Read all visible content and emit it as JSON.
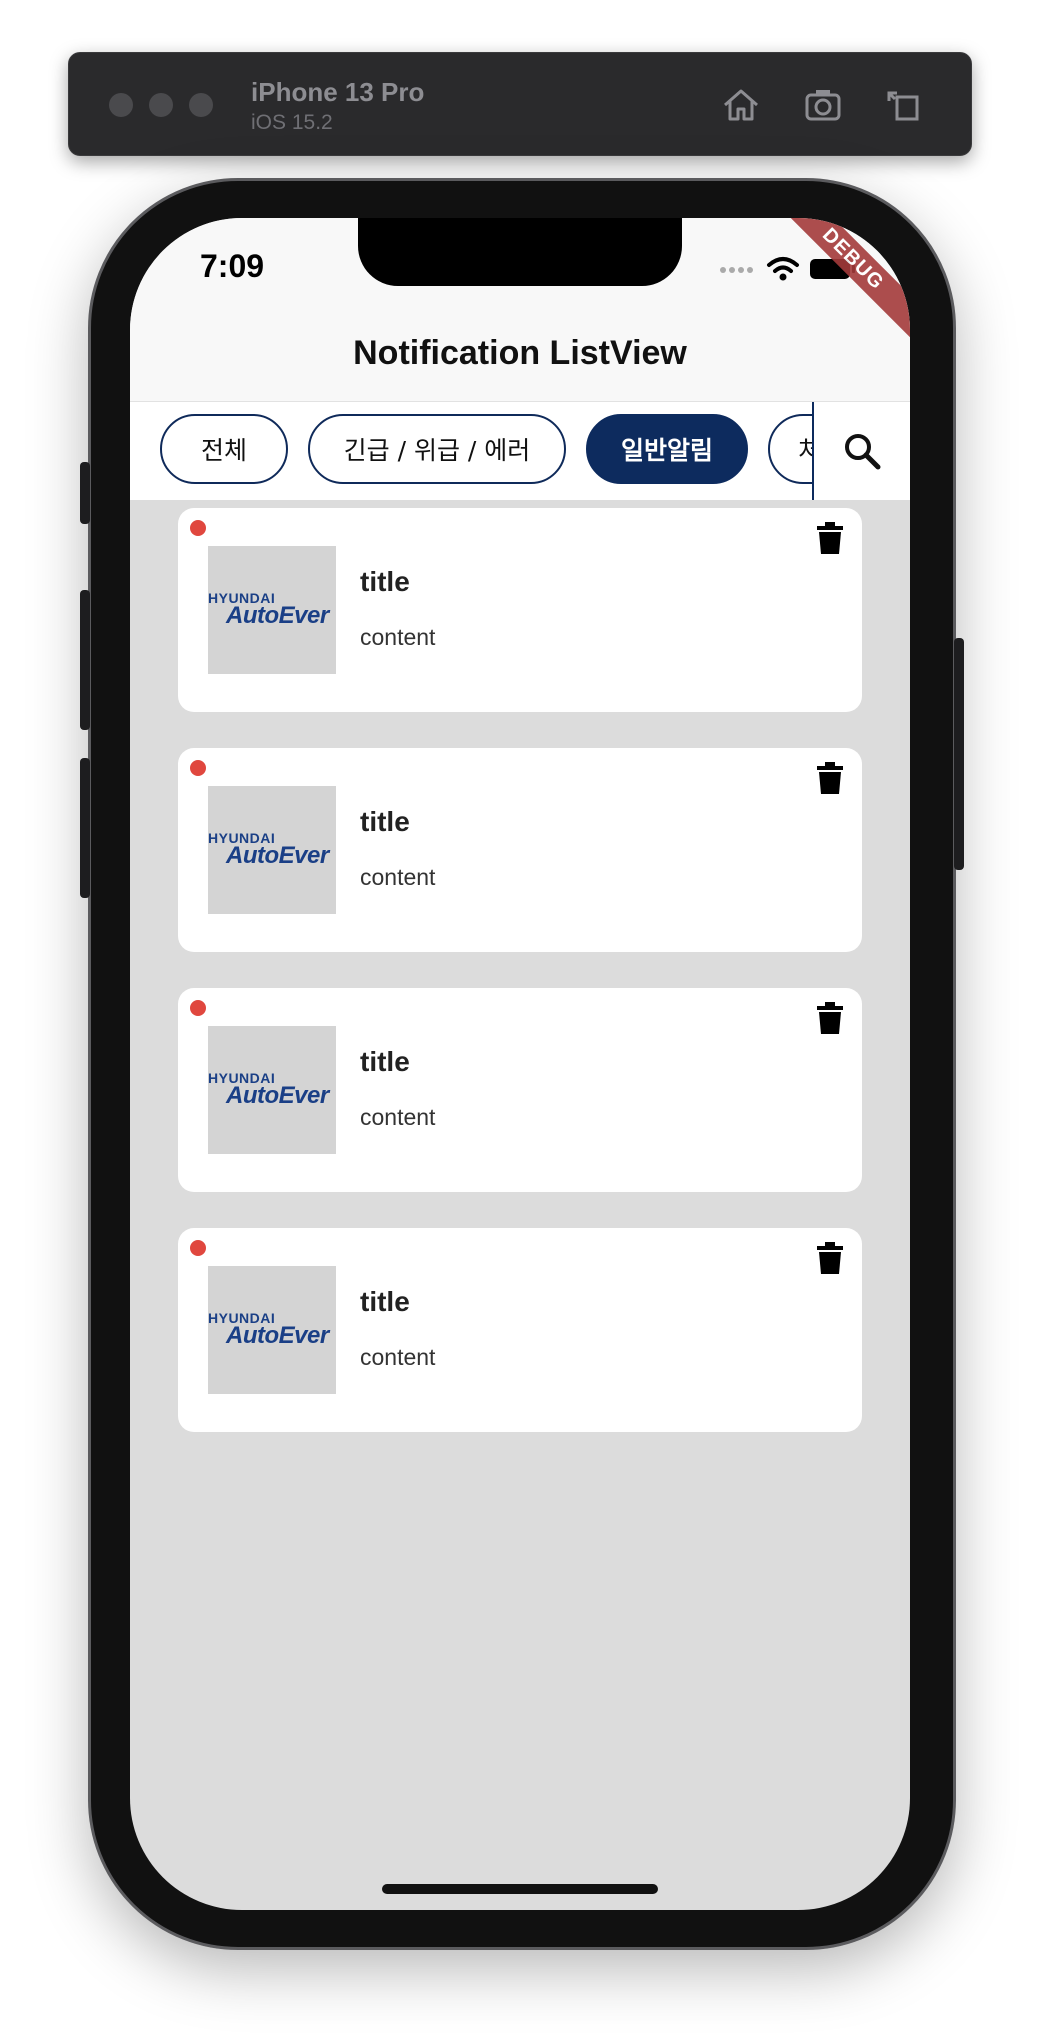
{
  "simulator": {
    "device_name": "iPhone 13 Pro",
    "os_version": "iOS 15.2"
  },
  "status_bar": {
    "time": "7:09"
  },
  "debug_banner": "DEBUG",
  "app_bar": {
    "title": "Notification ListView"
  },
  "filters": [
    {
      "label": "전체",
      "active": false
    },
    {
      "label": "긴급 / 위급 / 에러",
      "active": false
    },
    {
      "label": "일반알림",
      "active": true
    },
    {
      "label": "처",
      "active": false
    }
  ],
  "notifications": [
    {
      "title": "title",
      "content": "content",
      "logo_top": "HYUNDAI",
      "logo_bottom": "AutoEver",
      "unread": true
    },
    {
      "title": "title",
      "content": "content",
      "logo_top": "HYUNDAI",
      "logo_bottom": "AutoEver",
      "unread": true
    },
    {
      "title": "title",
      "content": "content",
      "logo_top": "HYUNDAI",
      "logo_bottom": "AutoEver",
      "unread": true
    },
    {
      "title": "title",
      "content": "content",
      "logo_top": "HYUNDAI",
      "logo_bottom": "AutoEver",
      "unread": true
    }
  ],
  "colors": {
    "accent": "#0d2b5e",
    "unread": "#e0473e",
    "background": "#dcdcdc"
  }
}
